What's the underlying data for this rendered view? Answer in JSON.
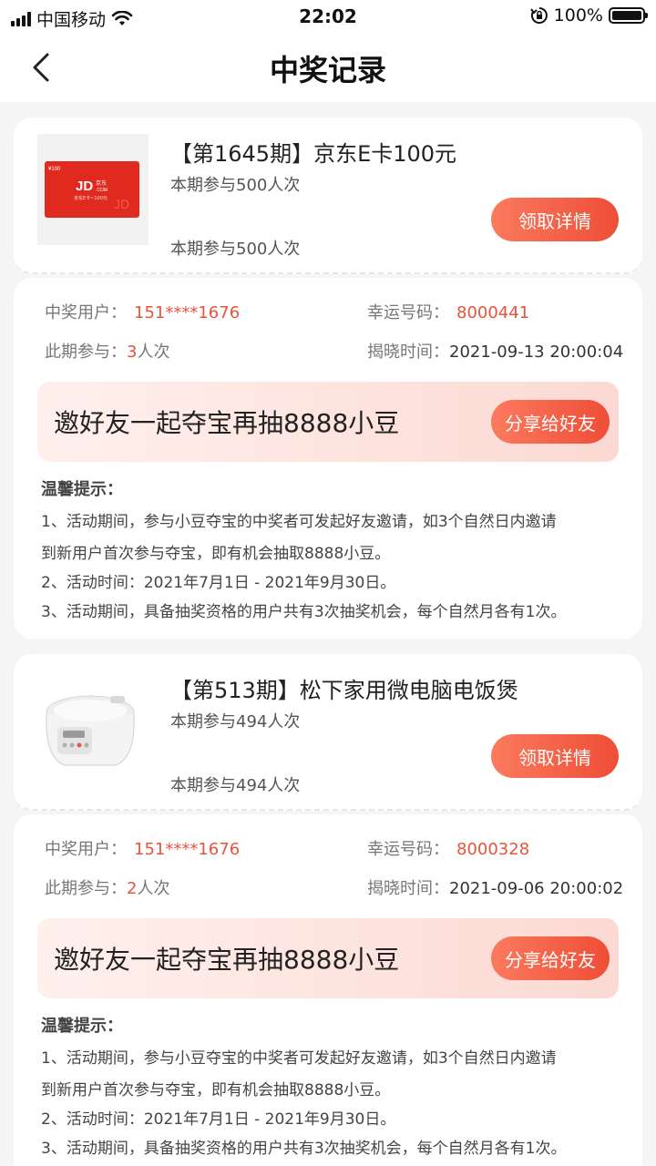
{
  "status_bar": {
    "carrier": "中国移动",
    "time": "22:02",
    "battery": "100%"
  },
  "nav": {
    "title": "中奖记录"
  },
  "records": [
    {
      "title": "【第1645期】京东E卡100元",
      "participants_line1": "本期参与500人次",
      "participants_line2": "本期参与500人次",
      "claim_label": "领取详情",
      "winner_label": "中奖用户：",
      "winner_value": "151****1676",
      "lucky_label": "幸运号码：",
      "lucky_value": "8000441",
      "period_label": "此期参与：",
      "period_count": "3",
      "period_unit": "人次",
      "reveal_label": "揭晓时间：",
      "reveal_value": "2021-09-13 20:00:04",
      "invite_text": "邀好友一起夺宝再抽8888小豆",
      "share_label": "分享给好友",
      "tips_title": "温馨提示：",
      "tips": [
        "1、活动期间，参与小豆夺宝的中奖者可发起好友邀请，如3个自然日内邀请",
        "到新用户首次参与夺宝，即有机会抽取8888小豆。",
        "2、活动时间：2021年7月1日 - 2021年9月30日。",
        "3、活动期间，具备抽奖资格的用户共有3次抽奖机会，每个自然月各有1次。"
      ],
      "product_image": {
        "type": "jd-card",
        "brand": "JD",
        "brand_cn": "京东",
        "domain": ".COM",
        "amount": "¥100",
        "caption": "京东E卡~100元"
      }
    },
    {
      "title": "【第513期】松下家用微电脑电饭煲",
      "participants_line1": "本期参与494人次",
      "participants_line2": "本期参与494人次",
      "claim_label": "领取详情",
      "winner_label": "中奖用户：",
      "winner_value": "151****1676",
      "lucky_label": "幸运号码：",
      "lucky_value": "8000328",
      "period_label": "此期参与：",
      "period_count": "2",
      "period_unit": "人次",
      "reveal_label": "揭晓时间：",
      "reveal_value": "2021-09-06 20:00:02",
      "invite_text": "邀好友一起夺宝再抽8888小豆",
      "share_label": "分享给好友",
      "tips_title": "温馨提示：",
      "tips": [
        "1、活动期间，参与小豆夺宝的中奖者可发起好友邀请，如3个自然日内邀请",
        "到新用户首次参与夺宝，即有机会抽取8888小豆。",
        "2、活动时间：2021年7月1日 - 2021年9月30日。",
        "3、活动期间，具备抽奖资格的用户共有3次抽奖机会，每个自然月各有1次。"
      ],
      "product_image": {
        "type": "rice-cooker"
      }
    }
  ],
  "colors": {
    "accent": "#ee4e36",
    "accent_light": "#fb7a5e",
    "value_red": "#e8533c"
  }
}
